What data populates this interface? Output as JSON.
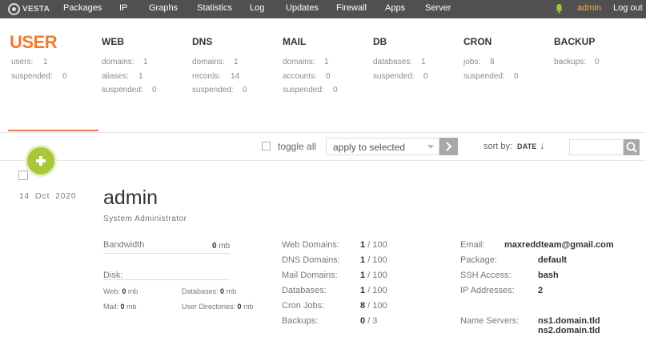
{
  "nav": {
    "logo": "VESTA",
    "items": [
      "Packages",
      "IP",
      "Graphs",
      "Statistics",
      "Log",
      "Updates",
      "Firewall",
      "Apps",
      "Server"
    ],
    "user": "admin",
    "logout": "Log out"
  },
  "summary": {
    "user": {
      "title": "USER",
      "stats": [
        {
          "k": "users:",
          "v": "1"
        },
        {
          "k": "suspended:",
          "v": "0"
        }
      ]
    },
    "web": {
      "title": "WEB",
      "stats": [
        {
          "k": "domains:",
          "v": "1"
        },
        {
          "k": "aliases:",
          "v": "1"
        },
        {
          "k": "suspended:",
          "v": "0"
        }
      ]
    },
    "dns": {
      "title": "DNS",
      "stats": [
        {
          "k": "domains:",
          "v": "1"
        },
        {
          "k": "records:",
          "v": "14"
        },
        {
          "k": "suspended:",
          "v": "0"
        }
      ]
    },
    "mail": {
      "title": "MAIL",
      "stats": [
        {
          "k": "domains:",
          "v": "1"
        },
        {
          "k": "accounts:",
          "v": "0"
        },
        {
          "k": "suspended:",
          "v": "0"
        }
      ]
    },
    "db": {
      "title": "DB",
      "stats": [
        {
          "k": "databases:",
          "v": "1"
        },
        {
          "k": "suspended:",
          "v": "0"
        }
      ]
    },
    "cron": {
      "title": "CRON",
      "stats": [
        {
          "k": "jobs:",
          "v": "8"
        },
        {
          "k": "suspended:",
          "v": "0"
        }
      ]
    },
    "backup": {
      "title": "BACKUP",
      "stats": [
        {
          "k": "backups:",
          "v": "0"
        }
      ]
    }
  },
  "toolbar": {
    "toggle_all": "toggle all",
    "action_selected": "apply to selected",
    "sort_by": "sort by:",
    "sort_value": "DATE",
    "sort_arrow": "↓",
    "search_value": ""
  },
  "record": {
    "date": "14 Oct 2020",
    "name": "admin",
    "role": "System Administrator",
    "bandwidth": {
      "label": "Bandwidth",
      "value": "0",
      "unit": "mb"
    },
    "disk": {
      "label": "Disk:"
    },
    "disk_web": {
      "label": "Web:",
      "value": "0",
      "unit": "mb"
    },
    "disk_db": {
      "label": "Databases:",
      "value": "0",
      "unit": "mb"
    },
    "disk_mail": {
      "label": "Mail:",
      "value": "0",
      "unit": "mb"
    },
    "disk_udir": {
      "label": "User Directories:",
      "value": "0",
      "unit": "mb"
    },
    "limits": [
      {
        "label": "Web Domains:",
        "used": "1",
        "total": "/ 100"
      },
      {
        "label": "DNS Domains:",
        "used": "1",
        "total": "/ 100"
      },
      {
        "label": "Mail Domains:",
        "used": "1",
        "total": "/ 100"
      },
      {
        "label": "Databases:",
        "used": "1",
        "total": "/ 100"
      },
      {
        "label": "Cron Jobs:",
        "used": "8",
        "total": "/ 100"
      },
      {
        "label": "Backups:",
        "used": "0",
        "total": "/ 3"
      }
    ],
    "info": [
      {
        "label": "Email:",
        "value": "maxreddteam@gmail.com"
      },
      {
        "label": "Package:",
        "value": "default"
      },
      {
        "label": "SSH Access:",
        "value": "bash"
      },
      {
        "label": "IP Addresses:",
        "value": "2"
      }
    ],
    "ns_label": "Name Servers:",
    "ns": [
      "ns1.domain.tld",
      "ns2.domain.tld"
    ]
  }
}
